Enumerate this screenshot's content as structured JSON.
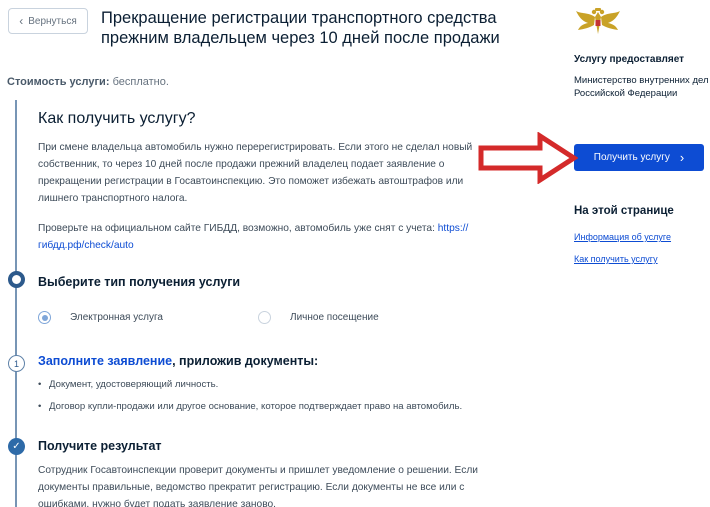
{
  "header": {
    "back_label": "Вернуться",
    "title": "Прекращение регистрации транспортного средства прежним владельцем через 10 дней после продажи"
  },
  "cost": {
    "label": "Стоимость услуги:",
    "value": "бесплатно."
  },
  "how": {
    "title": "Как получить услугу?",
    "paragraph1": "При смене владельца автомобиль нужно перерегистрировать. Если этого не сделал новый собственник, то через 10 дней после продажи прежний владелец подает заявление о прекращении регистрации в Госавтоинспекцию. Это поможет избежать автоштрафов или лишнего транспортного налога.",
    "paragraph2_text": "Проверьте на официальном сайте ГИБДД, возможно, автомобиль уже снят с учета:",
    "paragraph2_link": "https://гибдд.рф/check/auto"
  },
  "steps": {
    "step1": {
      "title": "Выберите тип получения услуги",
      "options": [
        "Электронная услуга",
        "Личное посещение"
      ],
      "selected": "Электронная услуга"
    },
    "step2": {
      "number": "1",
      "title_link": "Заполните заявление",
      "title_rest": ", приложив документы:",
      "documents": [
        "Документ, удостоверяющий личность.",
        "Договор купли-продажи или другое основание, которое подтверждает право на автомобиль."
      ]
    },
    "step3": {
      "check": "✓",
      "title": "Получите результат",
      "text": "Сотрудник Госавтоинспекции проверит документы и пришлет уведомление о решении. Если документы правильные, ведомство прекратит регистрацию. Если документы не все или с ошибками, нужно будет подать заявление заново."
    }
  },
  "sidebar": {
    "provider_label": "Услугу предоставляет",
    "provider_name": "Министерство внутренних дел Российской Федерации",
    "get_service_label": "Получить услугу",
    "on_page_title": "На этой странице",
    "anchors": [
      "Информация об услуге",
      "Как получить услугу"
    ]
  },
  "icons": {
    "back": "chevron-left-icon",
    "get_service": "chevron-right-icon",
    "emblem": "double-headed-eagle-emblem",
    "annotation": "red-arrow"
  },
  "colors": {
    "primary": "#0d4cd3",
    "text": "#0b1f33",
    "muted": "#66727f",
    "annotation_red": "#d42a2a",
    "emblem_gold": "#c9a227"
  }
}
